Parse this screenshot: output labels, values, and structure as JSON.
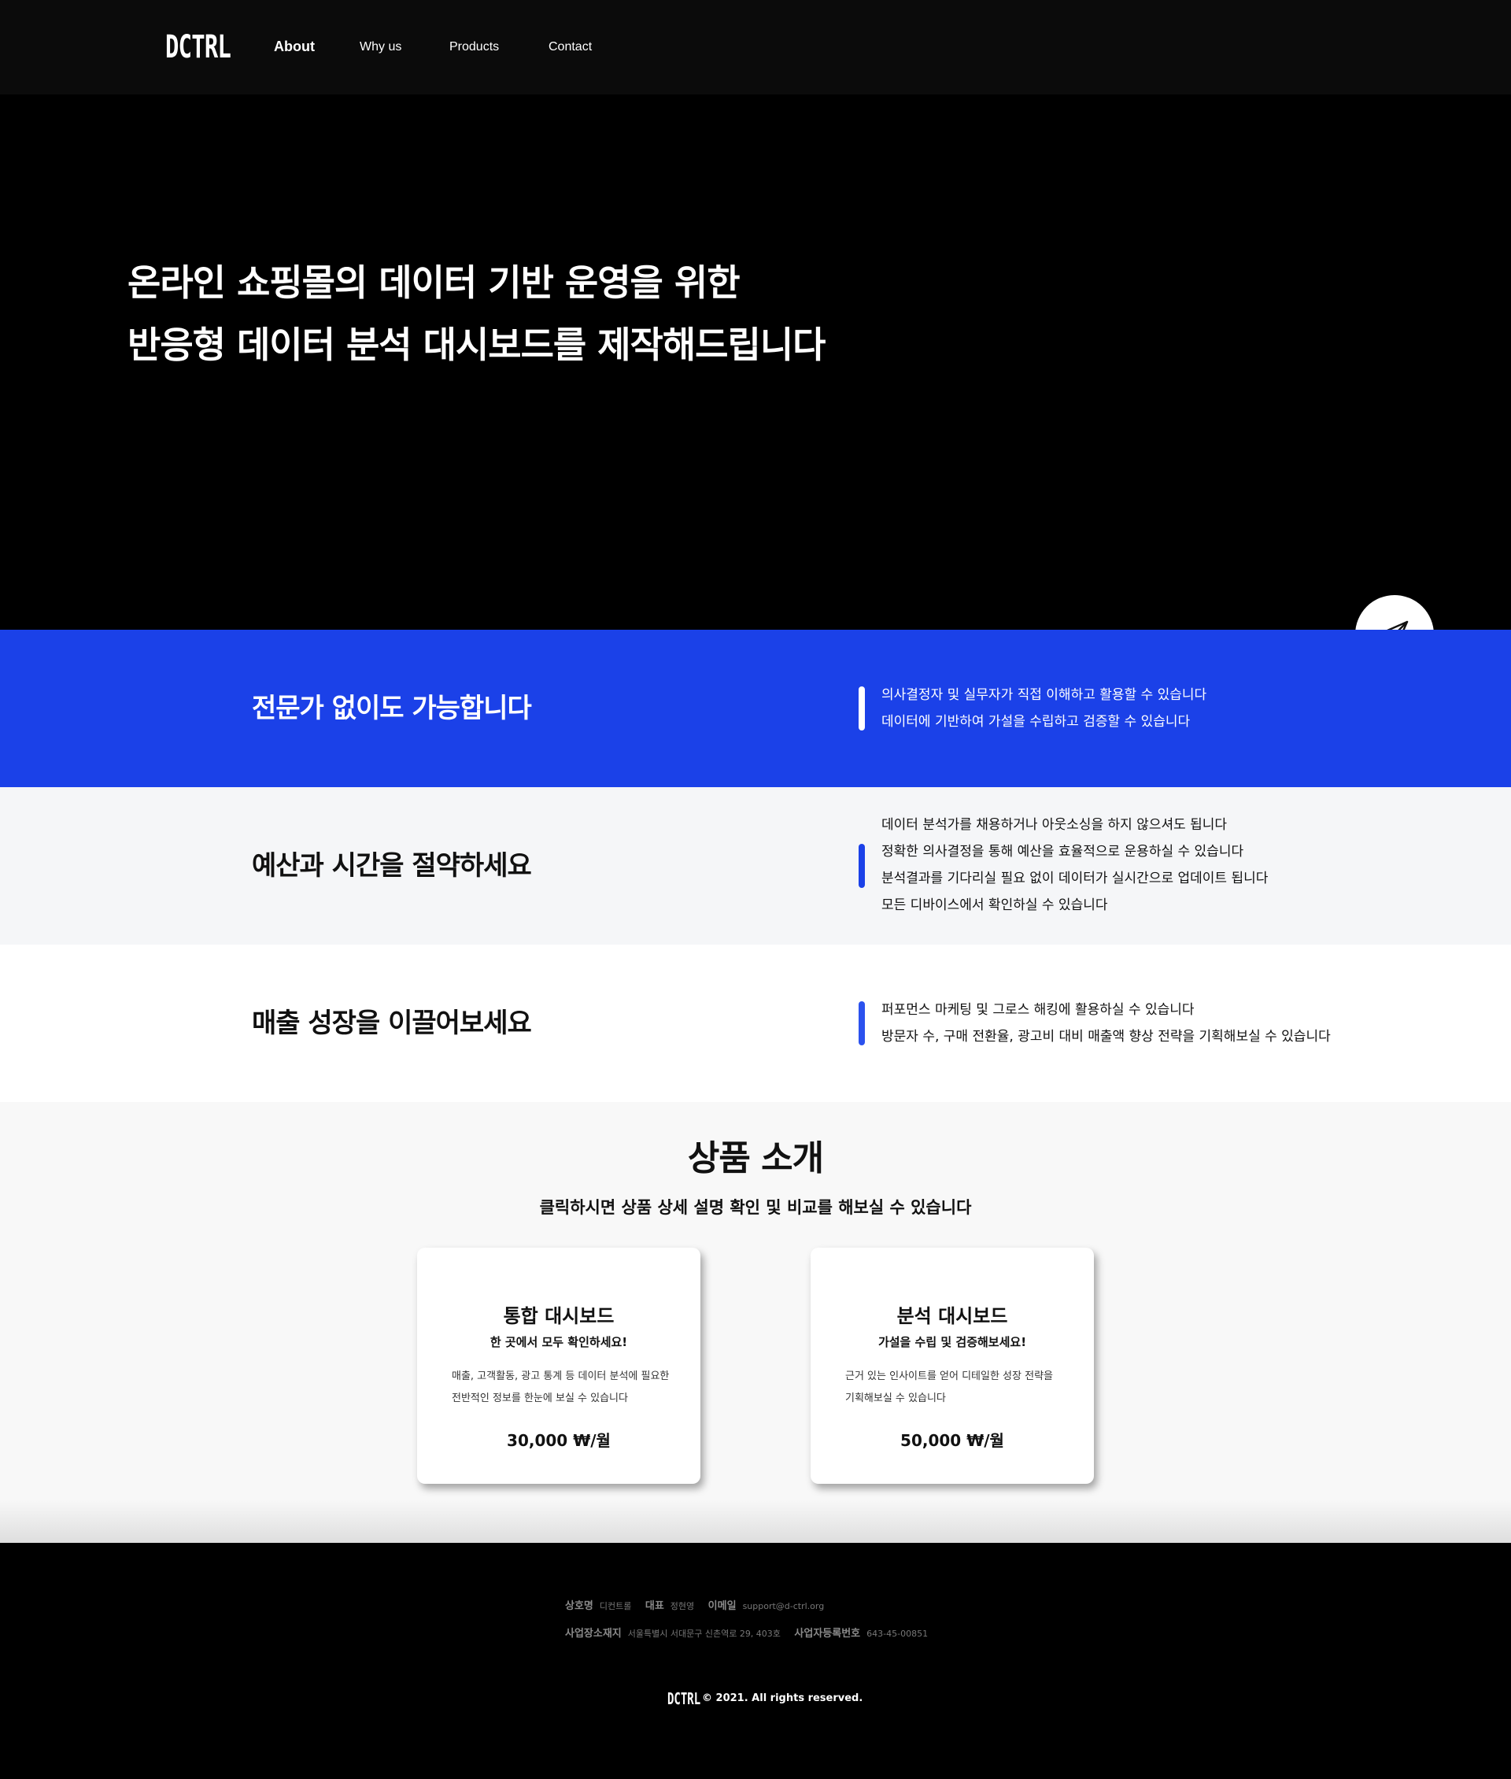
{
  "nav": {
    "logo": "DCTRL",
    "links": [
      "About",
      "Why us",
      "Products",
      "Contact"
    ]
  },
  "hero": {
    "line1": "온라인 쇼핑몰의 데이터 기반 운영을 위한",
    "line2": "반응형 데이터 분석 대시보드를 제작해드립니다",
    "fab_icon": "paper-plane-icon"
  },
  "features": [
    {
      "heading": "전문가 없이도 가능합니다",
      "lines": [
        "의사결정자 및 실무자가 직접 이해하고 활용할 수 있습니다",
        "데이터에 기반하여 가설을 수립하고 검증할 수 있습니다"
      ]
    },
    {
      "heading": "예산과 시간을 절약하세요",
      "lines": [
        "데이터 분석가를 채용하거나 아웃소싱을 하지 않으셔도 됩니다",
        "정확한 의사결정을 통해 예산을 효율적으로 운용하실 수 있습니다",
        "분석결과를 기다리실 필요 없이 데이터가 실시간으로 업데이트 됩니다",
        "모든 디바이스에서 확인하실 수 있습니다"
      ]
    },
    {
      "heading": "매출 성장을 이끌어보세요",
      "lines": [
        "퍼포먼스 마케팅 및 그로스 해킹에 활용하실 수 있습니다",
        "방문자 수, 구매 전환율, 광고비 대비 매출액 향상 전략을 기획해보실 수 있습니다"
      ]
    }
  ],
  "products": {
    "title": "상품 소개",
    "subtitle": "클릭하시면 상품 상세 설명 확인 및 비교를 해보실 수 있습니다",
    "cards": [
      {
        "name": "통합 대시보드",
        "tagline": "한 곳에서 모두 확인하세요!",
        "desc1": "매출, 고객활동, 광고 통계 등 데이터 분석에 필요한",
        "desc2": "전반적인 정보를 한눈에 보실 수 있습니다",
        "price": "30,000 ₩/월"
      },
      {
        "name": "분석 대시보드",
        "tagline": "가설을 수립 및 검증해보세요!",
        "desc1": "근거 있는 인사이트를 얻어 디테일한 성장 전략을",
        "desc2": "기획해보실 수 있습니다",
        "price": "50,000 ₩/월"
      }
    ]
  },
  "footer": {
    "company_label": "상호명",
    "company": "디컨트롤",
    "ceo_label": "대표",
    "ceo": "정현영",
    "email_label": "이메일",
    "email": "support@d-ctrl.org",
    "address_label": "사업장소재지",
    "address": "서울특별시 서대문구 신촌역로 29, 403호",
    "bizno_label": "사업자등록번호",
    "bizno": "643-45-00851",
    "logo": "DCTRL",
    "copyright": "© 2021. All rights reserved."
  },
  "colors": {
    "accent_blue": "#1b41e8",
    "nav_bg": "#0b0b0b",
    "hero_bg": "#000000"
  }
}
